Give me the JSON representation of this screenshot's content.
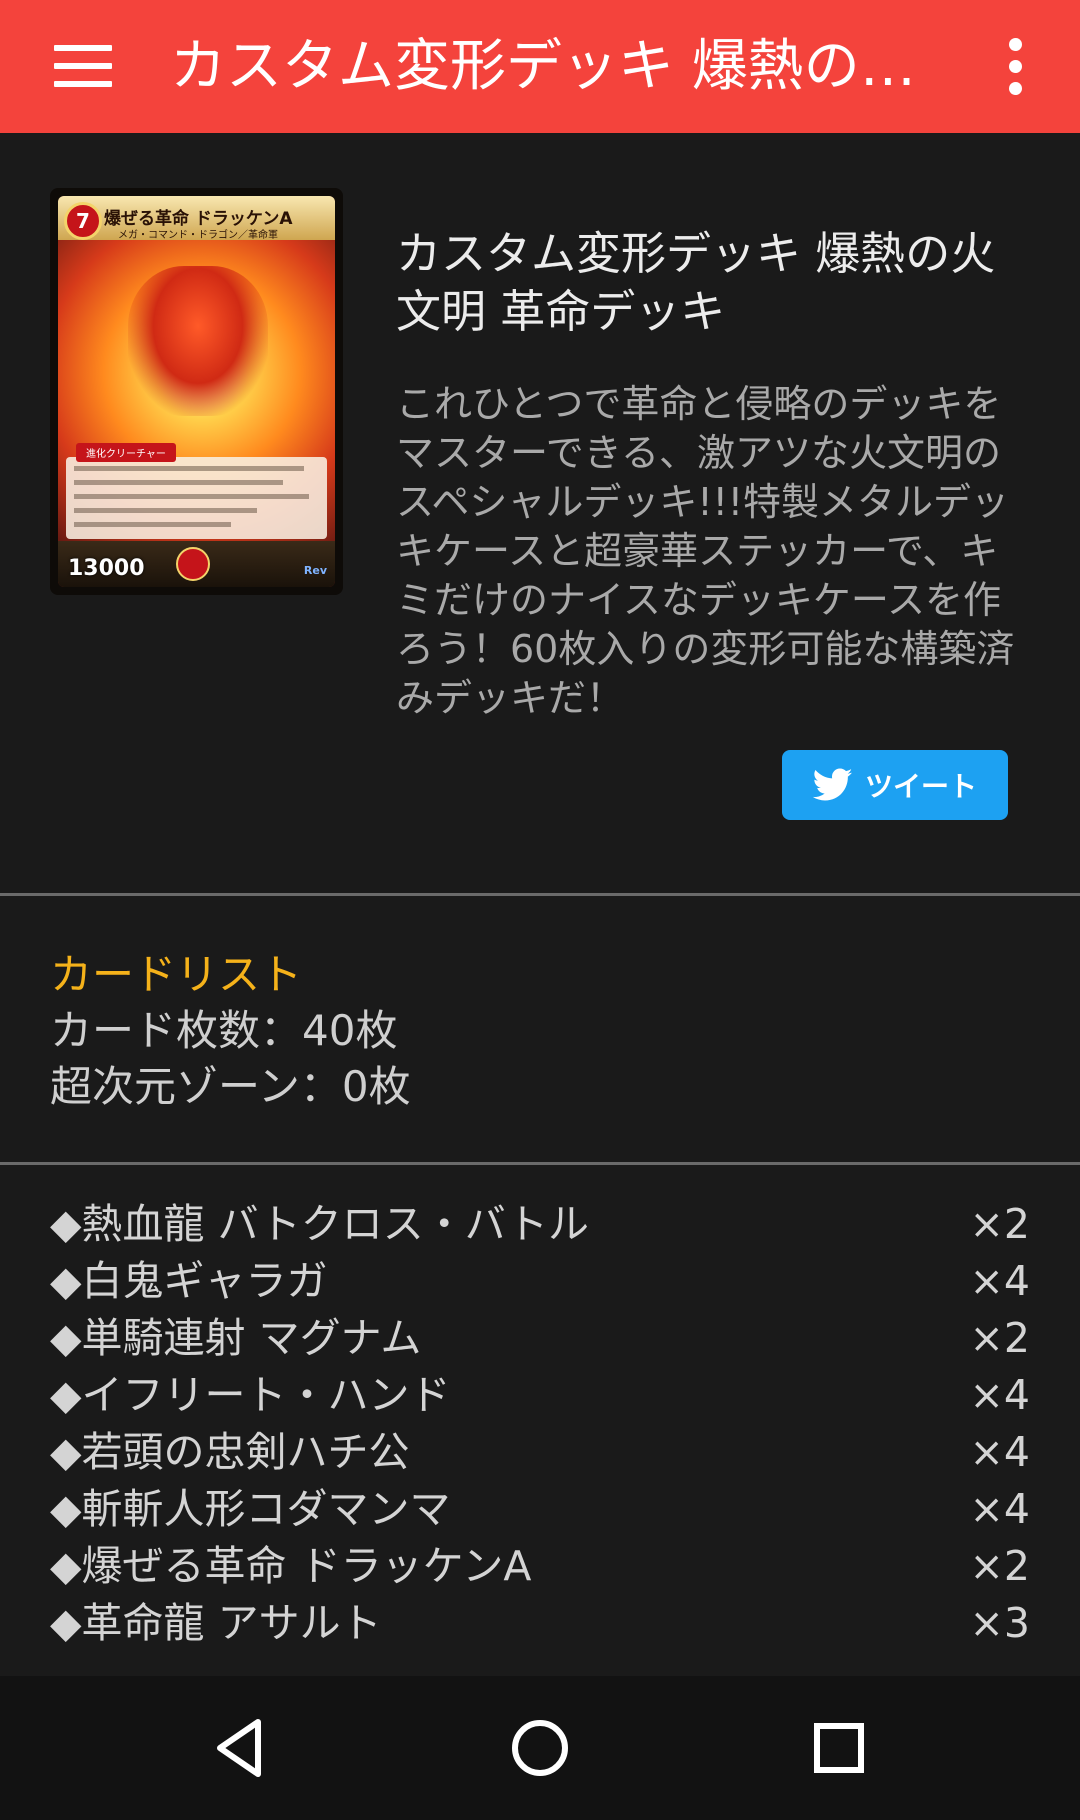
{
  "app_bar": {
    "title": "カスタム変形デッキ 爆熱の火文明 革命デッキ",
    "icons": {
      "menu": "hamburger-menu-icon",
      "overflow": "more-vert-icon"
    },
    "color": "#f4433c"
  },
  "product": {
    "card_image": {
      "cost": "7",
      "name": "爆ぜる革命 ドラッケンA",
      "subtitle": "メガ・コマンド・ドラゴン／革命軍",
      "type_tag": "進化クリーチャー",
      "power": "13000",
      "set_mark": "Rev"
    },
    "title": "カスタム変形デッキ 爆熱の火文明 革命デッキ",
    "description": "これひとつで革命と侵略のデッキをマスターできる、激アツな火文明のスペシャルデッキ!!!特製メタルデッキケースと超豪華ステッカーで、キミだけのナイスなデッキケースを作ろう！60枚入りの変形可能な構築済みデッキだ！",
    "tweet_button": {
      "label": "ツイート",
      "icon": "twitter-bird-icon",
      "color": "#1da1f2"
    }
  },
  "card_list": {
    "heading": "カードリスト",
    "card_count": "カード枚数：40枚",
    "hyperspace_zone": "超次元ゾーン：0枚",
    "accent_color": "#f5b21a"
  },
  "cards": [
    {
      "name": "◆熱血龍 バトクロス・バトル",
      "count": "×2"
    },
    {
      "name": "◆白鬼ギャラガ",
      "count": "×4"
    },
    {
      "name": "◆単騎連射 マグナム",
      "count": "×2"
    },
    {
      "name": "◆イフリート・ハンド",
      "count": "×4"
    },
    {
      "name": "◆若頭の忠剣ハチ公",
      "count": "×4"
    },
    {
      "name": "◆斬斬人形コダマンマ",
      "count": "×4"
    },
    {
      "name": "◆爆ぜる革命 ドラッケンA",
      "count": "×2"
    },
    {
      "name": "◆革命龍 アサルト",
      "count": "×3"
    }
  ],
  "nav_bar": {
    "icons": [
      "back-triangle-icon",
      "home-circle-icon",
      "recents-square-icon"
    ]
  }
}
